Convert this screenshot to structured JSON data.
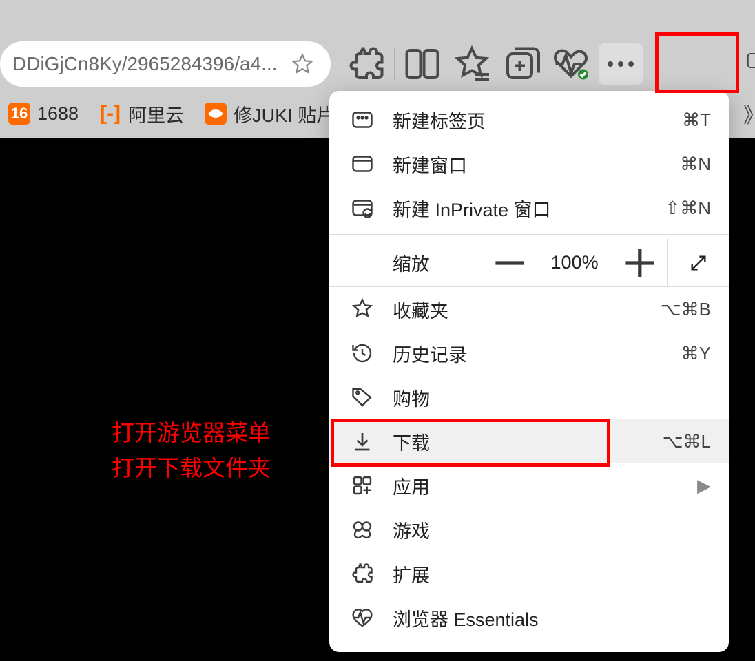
{
  "address_bar": {
    "url_display": "DDiGjCn8Ky/2965284396/a4..."
  },
  "bookmarks": [
    {
      "label": "1688",
      "icon_text": "16"
    },
    {
      "label": "阿里云",
      "icon_text": "[-]"
    },
    {
      "label": "修JUKI 贴片机"
    }
  ],
  "annotation": {
    "line1": "打开游览器菜单",
    "line2": "打开下载文件夹"
  },
  "menu": {
    "new_tab": {
      "label": "新建标签页",
      "shortcut": "⌘T"
    },
    "new_window": {
      "label": "新建窗口",
      "shortcut": "⌘N"
    },
    "new_inprivate": {
      "label": "新建 InPrivate 窗口",
      "shortcut": "⇧⌘N"
    },
    "zoom": {
      "label": "缩放",
      "value": "100%"
    },
    "favorites": {
      "label": "收藏夹",
      "shortcut": "⌥⌘B"
    },
    "history": {
      "label": "历史记录",
      "shortcut": "⌘Y"
    },
    "shopping": {
      "label": "购物"
    },
    "downloads": {
      "label": "下载",
      "shortcut": "⌥⌘L"
    },
    "apps": {
      "label": "应用"
    },
    "games": {
      "label": "游戏"
    },
    "extensions": {
      "label": "扩展"
    },
    "essentials": {
      "label": "浏览器 Essentials"
    }
  }
}
